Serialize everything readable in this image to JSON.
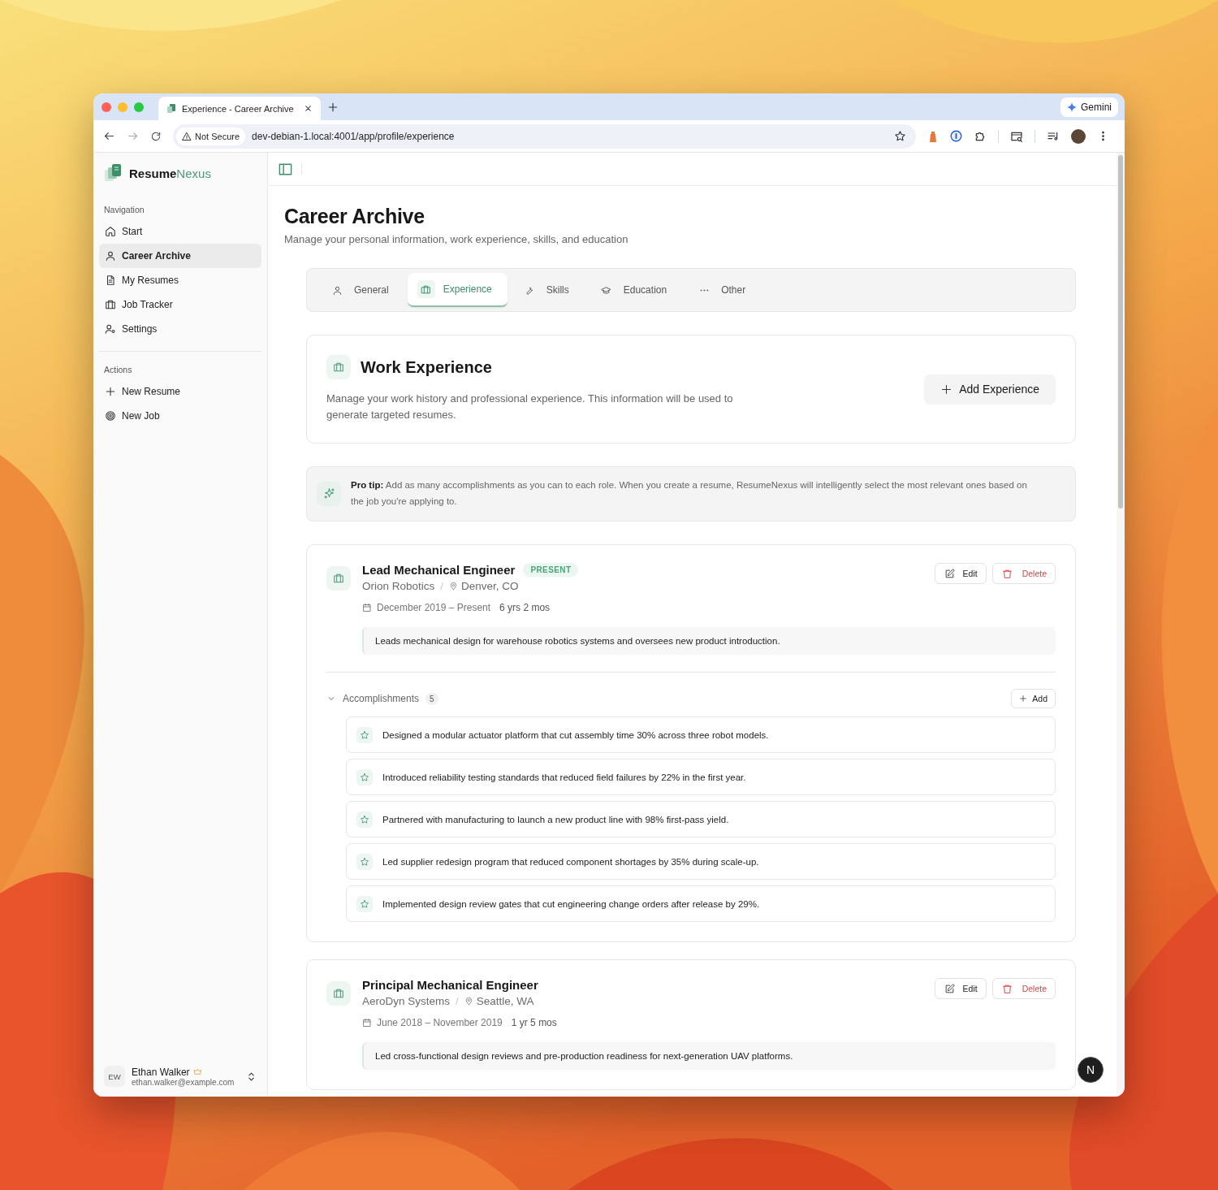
{
  "browser": {
    "tabs": [
      {
        "title": "Experience - Career Archive",
        "selected": true
      }
    ],
    "gemini": "Gemini",
    "security": "Not Secure",
    "url": "dev-debian-1.local:4001/app/profile/experience"
  },
  "sidebar": {
    "brand": {
      "first": "Resume",
      "second": "Nexus"
    },
    "sections": [
      {
        "heading": "Navigation",
        "items": [
          {
            "label": "Start",
            "selected": false
          },
          {
            "label": "Career Archive",
            "selected": true
          },
          {
            "label": "My Resumes",
            "selected": false
          },
          {
            "label": "Job Tracker",
            "selected": false
          },
          {
            "label": "Settings",
            "selected": false
          }
        ]
      },
      {
        "heading": "Actions",
        "items": [
          {
            "label": "New Resume",
            "selected": false
          },
          {
            "label": "New Job",
            "selected": false
          }
        ]
      }
    ],
    "user": {
      "initials": "EW",
      "name": "Ethan Walker",
      "email": "ethan.walker@example.com"
    }
  },
  "main": {
    "title": "Career Archive",
    "subtitle": "Manage your personal information, work experience, skills, and education",
    "tabs": [
      {
        "label": "General",
        "selected": false
      },
      {
        "label": "Experience",
        "selected": true
      },
      {
        "label": "Skills",
        "selected": false
      },
      {
        "label": "Education",
        "selected": false
      },
      {
        "label": "Other",
        "selected": false
      }
    ],
    "work": {
      "title": "Work Experience",
      "description": "Manage your work history and professional experience. This information will be used to generate targeted resumes.",
      "add_button": "Add Experience"
    },
    "tip": {
      "label": "Pro tip:",
      "text": "Add as many accomplishments as you can to each role. When you create a resume, ResumeNexus will intelligently select the most relevant ones based on the job you're applying to."
    },
    "experiences": [
      {
        "title": "Lead Mechanical Engineer",
        "badge": "PRESENT",
        "company": "Orion Robotics",
        "separator": "/",
        "location": "Denver, CO",
        "dates": "December 2019 – Present",
        "duration": "6 yrs 2 mos",
        "summary": "Leads mechanical design for warehouse robotics systems and oversees new product introduction.",
        "edit": "Edit",
        "delete": "Delete",
        "accomplishments": {
          "label": "Accomplishments",
          "count": "5",
          "add": "Add",
          "expanded": true,
          "items": [
            "Designed a modular actuator platform that cut assembly time 30% across three robot models.",
            "Introduced reliability testing standards that reduced field failures by 22% in the first year.",
            "Partnered with manufacturing to launch a new product line with 98% first-pass yield.",
            "Led supplier redesign program that reduced component shortages by 35% during scale-up.",
            "Implemented design review gates that cut engineering change orders after release by 29%."
          ]
        }
      },
      {
        "title": "Principal Mechanical Engineer",
        "company": "AeroDyn Systems",
        "separator": "/",
        "location": "Seattle, WA",
        "dates": "June 2018 – November 2019",
        "duration": "1 yr 5 mos",
        "summary": "Led cross-functional design reviews and pre-production readiness for next-generation UAV platforms.",
        "edit": "Edit",
        "delete": "Delete"
      }
    ],
    "fab": "N"
  }
}
